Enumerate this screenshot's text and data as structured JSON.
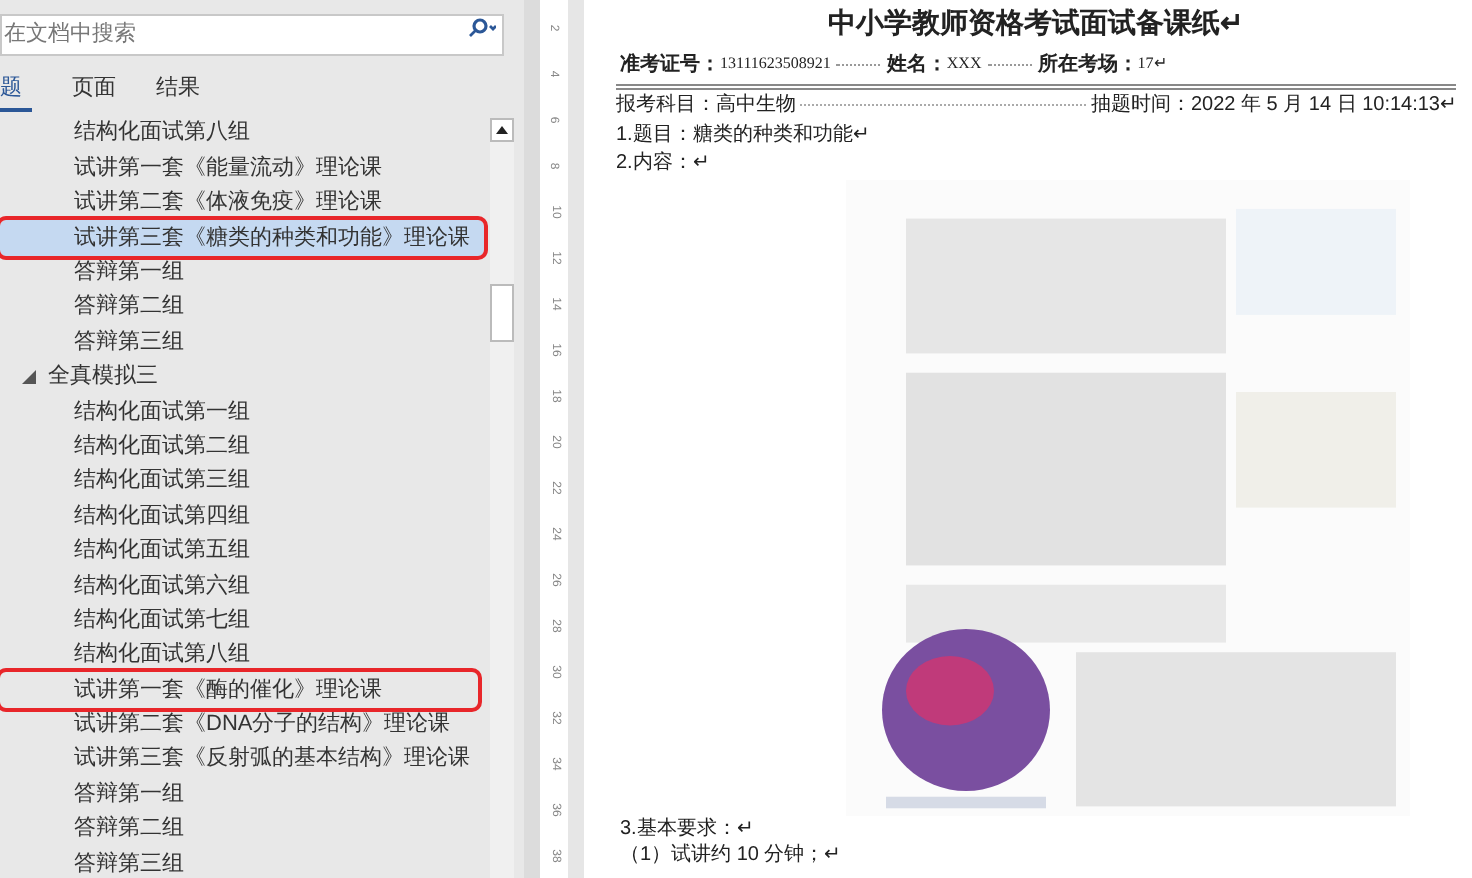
{
  "nav_pane": {
    "search": {
      "placeholder": "在文档中搜索"
    },
    "tabs": [
      {
        "label": "题",
        "selected": true
      },
      {
        "label": "页面",
        "selected": false
      },
      {
        "label": "结果",
        "selected": false
      }
    ],
    "continued_items": [
      {
        "label": "结构化面试第八组",
        "selected": false,
        "annotated": false
      },
      {
        "label": "试讲第一套《能量流动》理论课",
        "selected": false,
        "annotated": false
      },
      {
        "label": "试讲第二套《体液免疫》理论课",
        "selected": false,
        "annotated": false
      },
      {
        "label": "试讲第三套《糖类的种类和功能》理论课",
        "selected": true,
        "annotated": true
      },
      {
        "label": "答辩第一组",
        "selected": false,
        "annotated": false
      },
      {
        "label": "答辩第二组",
        "selected": false,
        "annotated": false
      },
      {
        "label": "答辩第三组",
        "selected": false,
        "annotated": false
      }
    ],
    "nodes": [
      {
        "label": "全真模拟三",
        "expanded": true,
        "children": [
          {
            "label": "结构化面试第一组",
            "selected": false,
            "annotated": false
          },
          {
            "label": "结构化面试第二组",
            "selected": false,
            "annotated": false
          },
          {
            "label": "结构化面试第三组",
            "selected": false,
            "annotated": false
          },
          {
            "label": "结构化面试第四组",
            "selected": false,
            "annotated": false
          },
          {
            "label": "结构化面试第五组",
            "selected": false,
            "annotated": false
          },
          {
            "label": "结构化面试第六组",
            "selected": false,
            "annotated": false
          },
          {
            "label": "结构化面试第七组",
            "selected": false,
            "annotated": false
          },
          {
            "label": "结构化面试第八组",
            "selected": false,
            "annotated": false
          },
          {
            "label": "试讲第一套《酶的催化》理论课",
            "selected": false,
            "annotated": true
          },
          {
            "label": "试讲第二套《DNA分子的结构》理论课",
            "selected": false,
            "annotated": false
          },
          {
            "label": "试讲第三套《反射弧的基本结构》理论课",
            "selected": false,
            "annotated": false
          },
          {
            "label": "答辩第一组",
            "selected": false,
            "annotated": false
          },
          {
            "label": "答辩第二组",
            "selected": false,
            "annotated": false
          },
          {
            "label": "答辩第三组",
            "selected": false,
            "annotated": false
          }
        ]
      }
    ]
  },
  "ruler": [
    "2",
    "4",
    "6",
    "8",
    "10",
    "12",
    "14",
    "16",
    "18",
    "20",
    "22",
    "24",
    "26",
    "28",
    "30",
    "32",
    "34",
    "36",
    "38"
  ],
  "document": {
    "title": "中小学教师资格考试面试备课纸↵",
    "info": [
      {
        "label": "准考证号：",
        "value": "13111623508921"
      },
      {
        "label": "姓名：",
        "value": "XXX"
      },
      {
        "label": "所在考场：",
        "value": "17↵"
      }
    ],
    "subject": "报考科目：高中生物",
    "draw_time": "抽题时间：2022 年 5 月 14 日 10:14:13↵",
    "lines_before": [
      "1.题目：糖类的种类和功能↵",
      "2.内容：↵"
    ],
    "figure": {
      "kind": "picture"
    },
    "lines_after": [
      "3.基本要求：↵",
      "（1）试讲约 10 分钟；↵"
    ]
  }
}
